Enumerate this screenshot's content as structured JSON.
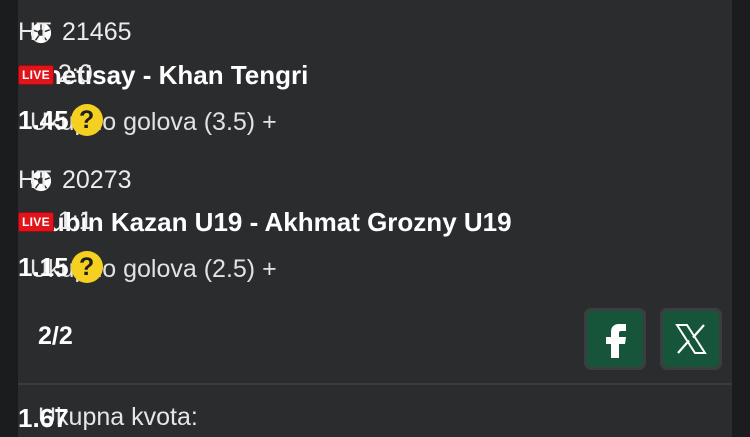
{
  "matches": [
    {
      "id": "21465",
      "status": "HT",
      "teams": "Zhetisay - Khan Tengri",
      "live_label": "LIVE",
      "score": "2:0",
      "market": "Ukupno golova (3.5) +",
      "odd": "1.45",
      "help": "?"
    },
    {
      "id": "20273",
      "status": "HT",
      "teams": "Rubin Kazan U19 - Akhmat Grozny U19",
      "live_label": "LIVE",
      "score": "1:1",
      "market": "Ukupno golova (2.5) +",
      "odd": "1.15",
      "help": "?"
    }
  ],
  "ticket": {
    "count": "2/2",
    "total_label": "Ukupna kvota:",
    "total_value": "1.67"
  },
  "share": {
    "facebook_icon": "facebook-icon",
    "x_icon": "x-icon"
  },
  "colors": {
    "live": "#e0141b",
    "help": "#f5d020",
    "share_bg": "#16553a"
  }
}
